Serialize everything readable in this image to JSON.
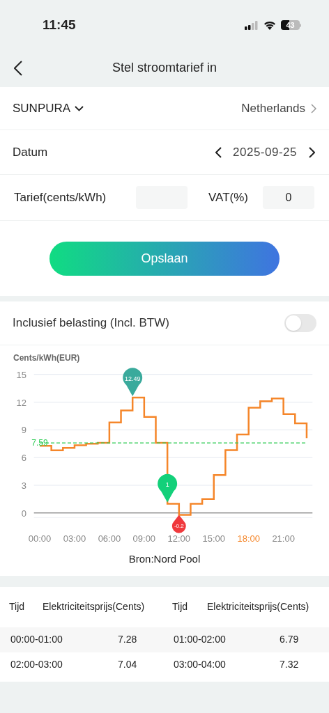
{
  "status_bar": {
    "time": "11:45",
    "battery": "43"
  },
  "header": {
    "title": "Stel stroomtarief in"
  },
  "settings": {
    "brand": "SUNPURA",
    "country": "Netherlands",
    "date_label": "Datum",
    "date": "2025-09-25",
    "tariff_label": "Tarief(cents/kWh)",
    "vat_label": "VAT(%)",
    "vat_value": "0",
    "save_button": "Opslaan"
  },
  "tax_toggle": {
    "label": "Inclusief belasting (Incl. BTW)",
    "on": false
  },
  "chart": {
    "source": "Bron:Nord Pool",
    "tick_states": [
      {
        "selected": false
      },
      {
        "selected": false
      },
      {
        "selected": false
      },
      {
        "selected": false
      },
      {
        "selected": false
      },
      {
        "selected": false
      },
      {
        "selected": true
      },
      {
        "selected": false
      }
    ],
    "markers": [
      {
        "color": "#2ecc55",
        "kind": "label"
      },
      {
        "color": "#3aaa9c",
        "kind": "above"
      },
      {
        "color": "#13d07a",
        "kind": "above"
      },
      {
        "color": "#f0393d",
        "kind": "below"
      }
    ],
    "chart_data": {
      "type": "line",
      "grid": true,
      "ylabel": "Cents/kWh(EUR)",
      "x": [
        0,
        1,
        1,
        2,
        2,
        3,
        3,
        4,
        4,
        5,
        5,
        6,
        6,
        7,
        7,
        8,
        8,
        9,
        9,
        10,
        10,
        11,
        11,
        12,
        12,
        13,
        13,
        14,
        14,
        15,
        15,
        16,
        16,
        17,
        17,
        18,
        18,
        19,
        19,
        20,
        20,
        21,
        21,
        22,
        22,
        23,
        23
      ],
      "series": [
        {
          "color": "#f5862a",
          "line_style": "solid",
          "values": [
            7.28,
            7.28,
            6.79,
            6.79,
            7.04,
            7.04,
            7.32,
            7.32,
            7.5,
            7.5,
            7.6,
            7.6,
            9.8,
            9.8,
            11.1,
            11.1,
            12.49,
            12.49,
            10.4,
            10.4,
            7.6,
            7.6,
            1,
            1,
            -0.2,
            -0.2,
            1.0,
            1.0,
            1.5,
            1.5,
            4.1,
            4.1,
            6.8,
            6.8,
            8.5,
            8.5,
            11.4,
            11.4,
            12.1,
            12.1,
            12.4,
            12.4,
            10.7,
            10.7,
            9.7,
            9.7,
            8.1
          ]
        },
        {
          "color": "#2ecc55",
          "line_style": "dashed",
          "values": [
            7.59,
            7.59,
            7.59,
            7.59,
            7.59,
            7.59,
            7.59,
            7.59,
            7.59,
            7.59,
            7.59,
            7.59,
            7.59,
            7.59,
            7.59,
            7.59,
            7.59,
            7.59,
            7.59,
            7.59,
            7.59,
            7.59,
            7.59,
            7.59,
            7.59,
            7.59,
            7.59,
            7.59,
            7.59,
            7.59,
            7.59,
            7.59,
            7.59,
            7.59,
            7.59,
            7.59,
            7.59,
            7.59,
            7.59,
            7.59,
            7.59,
            7.59,
            7.59,
            7.59,
            7.59,
            7.59,
            7.59
          ]
        }
      ],
      "xlim": [
        -0.5,
        23.5
      ],
      "ylim": [
        -0.5,
        15
      ],
      "yticks": [
        0,
        3,
        6,
        9,
        12,
        15
      ],
      "xticks": [
        {
          "value": 0,
          "label": "00:00"
        },
        {
          "value": 3,
          "label": "03:00"
        },
        {
          "value": 6,
          "label": "06:00"
        },
        {
          "value": 9,
          "label": "09:00"
        },
        {
          "value": 12,
          "label": "12:00"
        },
        {
          "value": 15,
          "label": "15:00"
        },
        {
          "value": 18,
          "label": "18:00"
        },
        {
          "value": 21,
          "label": "21:00"
        }
      ],
      "annotations": [
        {
          "x": 0,
          "y": 7.59,
          "text": "7.59"
        },
        {
          "x": 8,
          "y": 12.49,
          "text": "12.49"
        },
        {
          "x": 11,
          "y": 1,
          "text": "1"
        },
        {
          "x": 12,
          "y": -0.2,
          "text": "-0.2"
        }
      ]
    }
  },
  "table": {
    "columns": [
      "Tijd",
      "Elektriciteitsprijs(Cents)",
      "Tijd",
      "Elektriciteitsprijs(Cents)"
    ],
    "rows": [
      [
        "00:00-01:00",
        "7.28",
        "01:00-02:00",
        "6.79"
      ],
      [
        "02:00-03:00",
        "7.04",
        "03:00-04:00",
        "7.32"
      ]
    ]
  }
}
